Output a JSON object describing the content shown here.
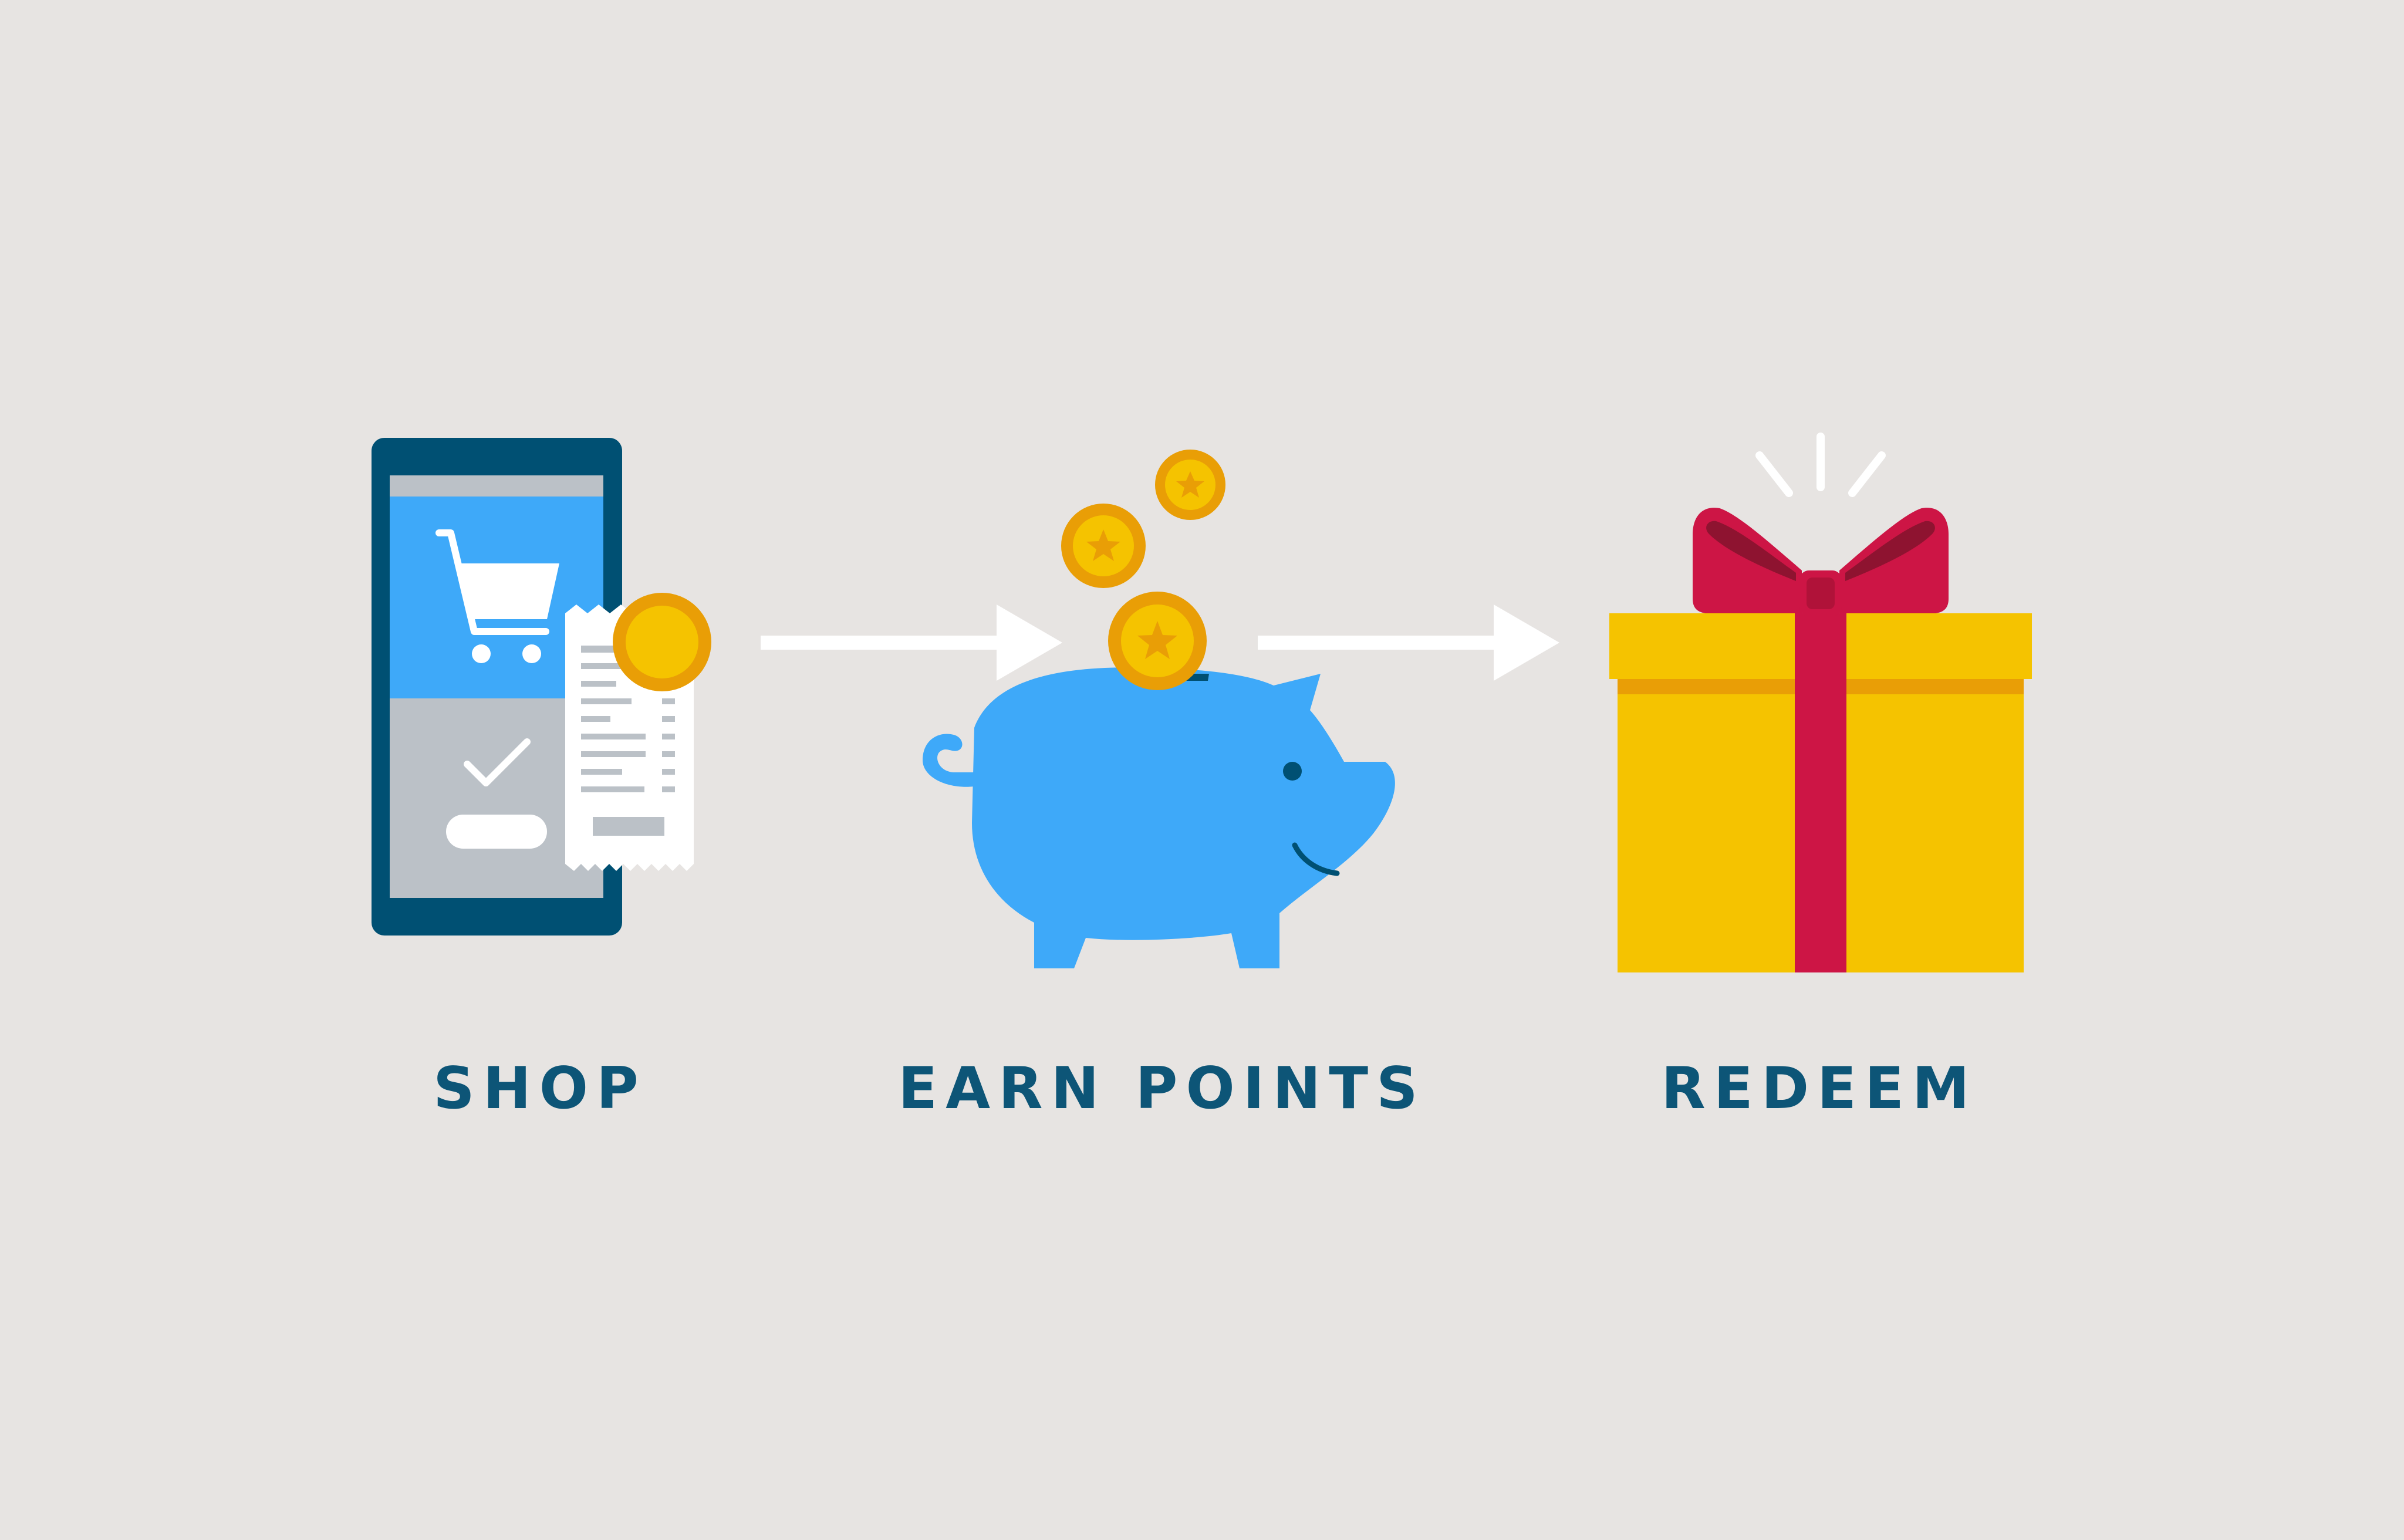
{
  "steps": [
    {
      "label": "SHOP",
      "icon": "phone-shopping-cart-receipt-icon"
    },
    {
      "label": "EARN POINTS",
      "icon": "piggy-bank-coins-icon"
    },
    {
      "label": "REDEEM",
      "icon": "gift-box-icon"
    }
  ],
  "colors": {
    "background": "#e7e4e2",
    "label_text": "#0d5577",
    "phone_frame": "#005073",
    "screen_blue": "#3ea9f9",
    "screen_gray": "#bbc1c7",
    "coin_outer": "#e99e06",
    "coin_inner": "#f5c300",
    "piggy": "#3ea9f9",
    "gift_box": "#f5c300",
    "gift_ribbon": "#cd1545",
    "arrow": "#ffffff"
  }
}
